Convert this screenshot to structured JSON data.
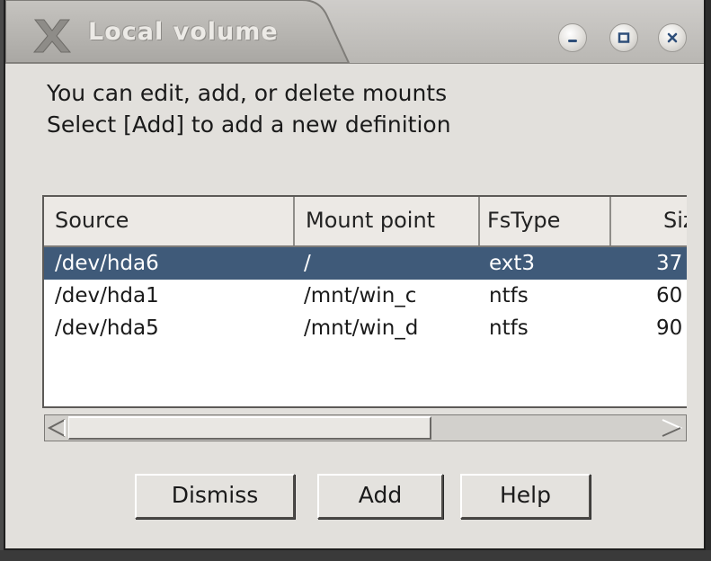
{
  "window": {
    "title": "Local volume",
    "icons": {
      "logo": "x-logo-icon",
      "minimize": "minimize-icon",
      "maximize": "maximize-icon",
      "close": "close-icon"
    }
  },
  "instructions": {
    "line1": "You can edit, add, or delete mounts",
    "line2": "Select [Add] to add a new definition"
  },
  "list": {
    "columns": [
      "Source",
      "Mount point",
      "FsType",
      "Siz"
    ],
    "rows": [
      {
        "source": "/dev/hda6",
        "mount": "/",
        "fstype": "ext3",
        "size": "37",
        "selected": true
      },
      {
        "source": "/dev/hda1",
        "mount": "/mnt/win_c",
        "fstype": "ntfs",
        "size": "60",
        "selected": false
      },
      {
        "source": "/dev/hda5",
        "mount": "/mnt/win_d",
        "fstype": "ntfs",
        "size": "90",
        "selected": false
      }
    ],
    "selected_color": "#3f5a79"
  },
  "scrollbar": {
    "left_icon": "scroll-left-arrow-icon",
    "right_icon": "scroll-right-arrow-icon"
  },
  "buttons": {
    "dismiss": "Dismiss",
    "add": "Add",
    "help": "Help"
  }
}
